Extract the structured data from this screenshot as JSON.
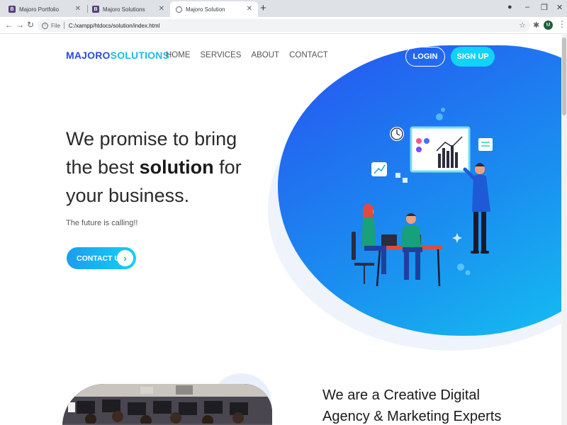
{
  "browser": {
    "tabs": [
      {
        "title": "Majoro Portfolio",
        "favicon": "B",
        "active": false
      },
      {
        "title": "Majoro Solutions",
        "favicon": "B",
        "active": false
      },
      {
        "title": "Majoro Solution",
        "favicon": "globe",
        "active": true
      }
    ],
    "new_tab": "+",
    "url_scheme_label": "File",
    "url": "C:/xampp/htdocs/solution/index.html",
    "profile_initial": "M"
  },
  "site": {
    "logo_part1": "MAJORO",
    "logo_part2": "SOLUTIONS",
    "nav": [
      "HOME",
      "SERVICES",
      "ABOUT",
      "CONTACT"
    ],
    "login_label": "LOGIN",
    "signup_label": "SIGN UP",
    "hero": {
      "line1": "We promise to bring",
      "line2_pre": "the best ",
      "line2_bold": "solution",
      "line2_post": " for",
      "line3": "your business.",
      "tagline": "The future is calling!!",
      "cta_label": "CONTACT US",
      "cta_arrow": "›"
    },
    "about": {
      "line1": "We are a Creative Digital",
      "line2": "Agency & Marketing Experts"
    },
    "colors": {
      "brand_dark": "#2a49e0",
      "brand_light": "#1dbbea",
      "hero_gradient_start": "#2753f0",
      "hero_gradient_end": "#14c6f1",
      "signup_bg": "#10d3f5"
    }
  }
}
